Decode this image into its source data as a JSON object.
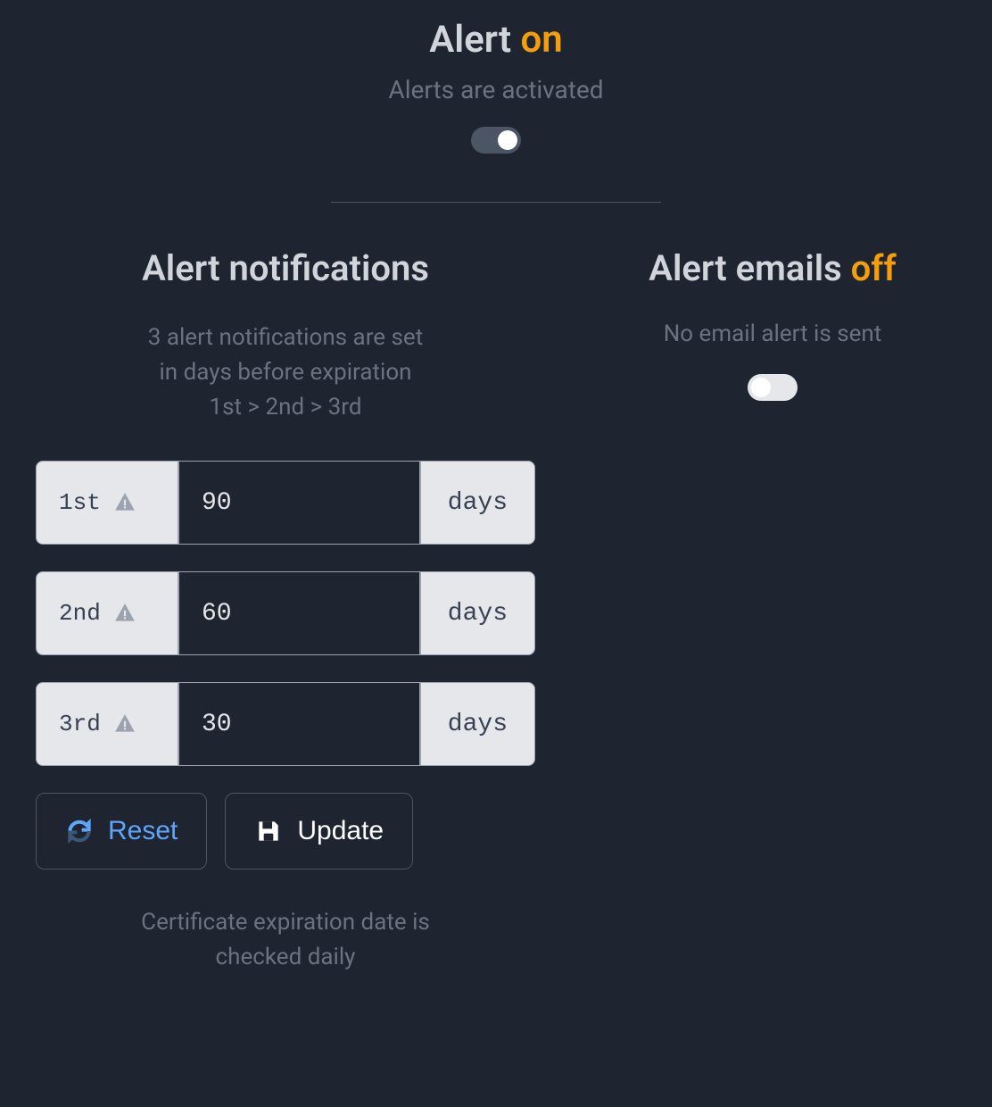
{
  "header": {
    "title_prefix": "Alert ",
    "title_status": "on",
    "subtitle": "Alerts are activated",
    "toggle_state": "on"
  },
  "notifications": {
    "title": "Alert notifications",
    "sub_line1": "3 alert notifications are set",
    "sub_line2": "in days before expiration",
    "sub_line3": "1st > 2nd > 3rd",
    "rows": [
      {
        "label": "1st",
        "value": "90",
        "suffix": "days"
      },
      {
        "label": "2nd",
        "value": "60",
        "suffix": "days"
      },
      {
        "label": "3rd",
        "value": "30",
        "suffix": "days"
      }
    ],
    "reset_label": "Reset",
    "update_label": "Update",
    "footer_line1": "Certificate expiration date is",
    "footer_line2": "checked daily"
  },
  "emails": {
    "title_prefix": "Alert emails ",
    "title_status": "off",
    "subtitle": "No email alert is sent",
    "toggle_state": "off"
  }
}
